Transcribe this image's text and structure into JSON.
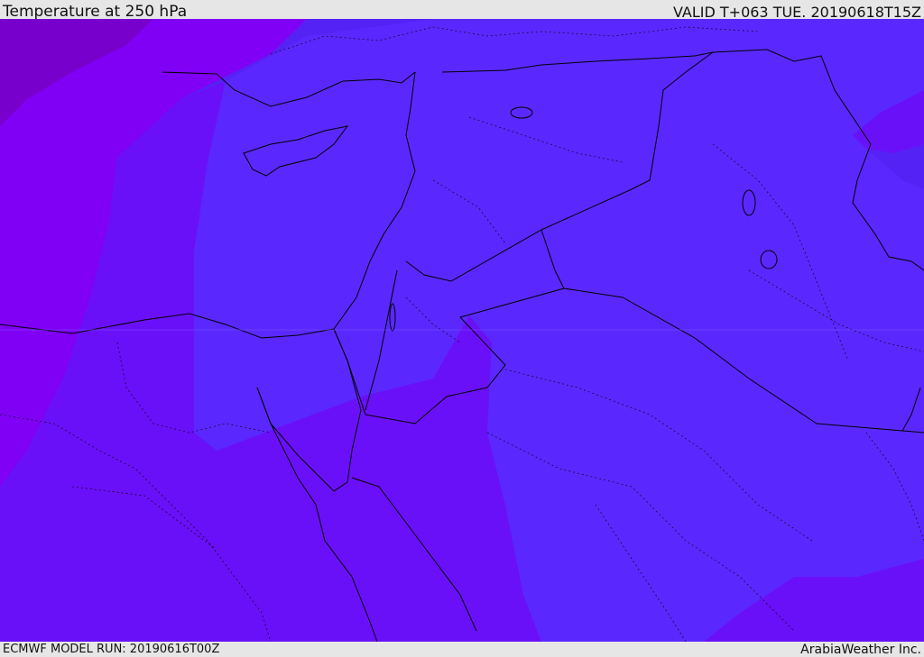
{
  "header": {
    "title": "Temperature at 250 hPa",
    "valid": "VALID T+063 TUE. 20190618T15Z"
  },
  "footer": {
    "model_run": "ECMWF MODEL RUN: 20190616T00Z",
    "credit": "ArabiaWeather Inc."
  },
  "colors": {
    "coldest": "#7700cc",
    "cold": "#8000f5",
    "mid": "#6a10f8",
    "warm": "#5522f5",
    "warmest": "#5a28ff",
    "boundary": "#000000",
    "panel": "#e6e6e6"
  }
}
